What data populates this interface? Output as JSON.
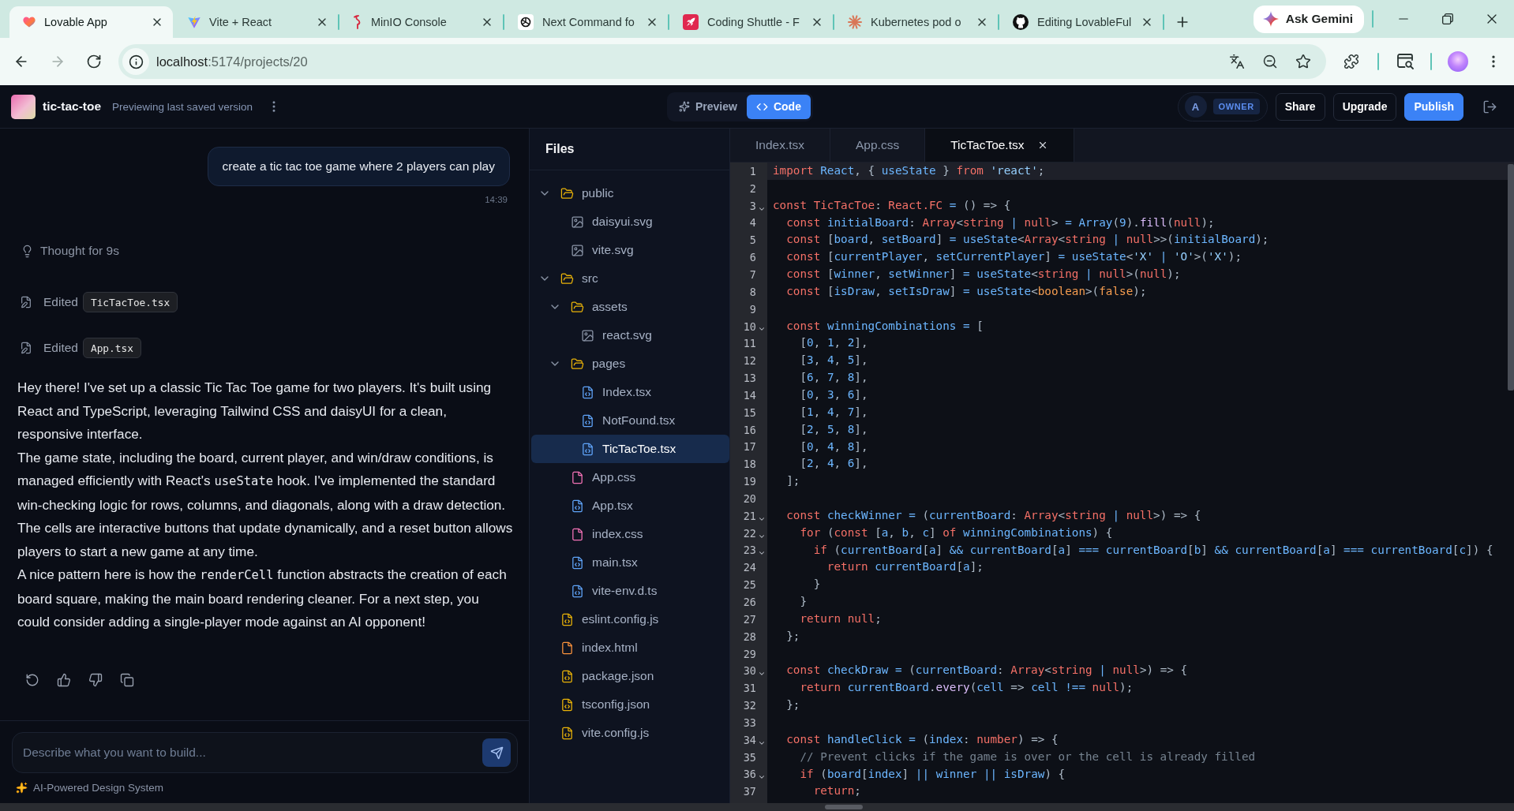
{
  "browser": {
    "tabs": [
      {
        "title": "Lovable App",
        "selected": true
      },
      {
        "title": "Vite + React",
        "selected": false
      },
      {
        "title": "MinIO Console",
        "selected": false
      },
      {
        "title": "Next Command fo",
        "selected": false
      },
      {
        "title": "Coding Shuttle - F",
        "selected": false
      },
      {
        "title": "Kubernetes pod o",
        "selected": false
      },
      {
        "title": "Editing LovableFul",
        "selected": false
      }
    ],
    "gemini_button": "Ask Gemini",
    "nav_buttons": [
      {
        "disabled": false
      },
      {
        "disabled": true
      },
      {
        "disabled": false
      }
    ],
    "address": {
      "host": "localhost",
      "path": ":5174/projects/20"
    }
  },
  "app_header": {
    "project_name": "tic-tac-toe",
    "status": "Previewing last saved version",
    "view_tabs": [
      {
        "label": "Preview",
        "selected": false
      },
      {
        "label": "Code",
        "selected": true
      }
    ],
    "member": {
      "initial": "A",
      "role": "OWNER"
    },
    "buttons": [
      {
        "label": "Share",
        "kind": "secondary"
      },
      {
        "label": "Upgrade",
        "kind": "secondary"
      },
      {
        "label": "Publish",
        "kind": "primary"
      }
    ]
  },
  "chat": {
    "user_message": {
      "text": "create a tic tac toe game where 2 players can play",
      "time": "14:39"
    },
    "thought": "Thought for 9s",
    "edits": [
      {
        "action": "Edited",
        "file": "TicTacToe.tsx"
      },
      {
        "action": "Edited",
        "file": "App.tsx"
      }
    ],
    "reply": [
      [
        {
          "kind": "text",
          "text": "Hey there! I've set up a classic Tic Tac Toe game for two players. It's built using React and TypeScript, leveraging Tailwind CSS and daisyUI for a clean, responsive interface."
        }
      ],
      [
        {
          "kind": "text",
          "text": "The game state, including the board, current player, and win/draw conditions, is managed efficiently with React's "
        },
        {
          "kind": "code",
          "text": "useState"
        },
        {
          "kind": "text",
          "text": " hook. I've implemented the standard win-checking logic for rows, columns, and diagonals, along with a draw detection. The cells are interactive buttons that update dynamically, and a reset button allows players to start a new game at any time."
        }
      ],
      [
        {
          "kind": "text",
          "text": "A nice pattern here is how the "
        },
        {
          "kind": "code",
          "text": "renderCell"
        },
        {
          "kind": "text",
          "text": " function abstracts the creation of each board square, making the main board rendering cleaner. For a next step, you could consider adding a single-player mode against an AI opponent!"
        }
      ]
    ],
    "composer": {
      "placeholder": "Describe what you want to build..."
    },
    "footer_note": "AI-Powered Design System"
  },
  "files": {
    "title": "Files",
    "tree": [
      {
        "name": "public",
        "kind": "folder",
        "expanded": true,
        "selected": false,
        "children": [
          {
            "name": "daisyui.svg",
            "kind": "image",
            "selected": false
          },
          {
            "name": "vite.svg",
            "kind": "image",
            "selected": false
          }
        ]
      },
      {
        "name": "src",
        "kind": "folder",
        "expanded": true,
        "selected": false,
        "children": [
          {
            "name": "assets",
            "kind": "folder",
            "expanded": true,
            "selected": false,
            "children": [
              {
                "name": "react.svg",
                "kind": "image",
                "selected": false
              }
            ]
          },
          {
            "name": "pages",
            "kind": "folder",
            "expanded": true,
            "selected": false,
            "children": [
              {
                "name": "Index.tsx",
                "kind": "script",
                "selected": false
              },
              {
                "name": "NotFound.tsx",
                "kind": "script",
                "selected": false
              },
              {
                "name": "TicTacToe.tsx",
                "kind": "script",
                "selected": true
              }
            ]
          },
          {
            "name": "App.css",
            "kind": "style",
            "selected": false
          },
          {
            "name": "App.tsx",
            "kind": "script",
            "selected": false
          },
          {
            "name": "index.css",
            "kind": "style",
            "selected": false
          },
          {
            "name": "main.tsx",
            "kind": "script",
            "selected": false
          },
          {
            "name": "vite-env.d.ts",
            "kind": "script",
            "selected": false
          }
        ]
      },
      {
        "name": "eslint.config.js",
        "kind": "config",
        "selected": false
      },
      {
        "name": "index.html",
        "kind": "markup",
        "selected": false
      },
      {
        "name": "package.json",
        "kind": "config",
        "selected": false
      },
      {
        "name": "tsconfig.json",
        "kind": "config",
        "selected": false
      },
      {
        "name": "vite.config.js",
        "kind": "config",
        "selected": false
      }
    ]
  },
  "editor": {
    "tabs": [
      {
        "title": "Index.tsx",
        "selected": false
      },
      {
        "title": "App.css",
        "selected": false
      },
      {
        "title": "TicTacToe.tsx",
        "selected": true
      }
    ],
    "lines": [
      {
        "number": "1",
        "active": true,
        "foldable": false,
        "tokens": [
          {
            "kind": "keyword",
            "text": "import "
          },
          {
            "kind": "name",
            "text": "React"
          },
          {
            "kind": "punct",
            "text": ", { "
          },
          {
            "kind": "name",
            "text": "useState"
          },
          {
            "kind": "punct",
            "text": " } "
          },
          {
            "kind": "keyword",
            "text": "from "
          },
          {
            "kind": "string",
            "text": "'react'"
          },
          {
            "kind": "punct",
            "text": ";"
          }
        ]
      },
      {
        "number": "2",
        "active": false,
        "foldable": false
      },
      {
        "number": "3",
        "active": false,
        "foldable": true,
        "tokens": [
          {
            "kind": "keyword",
            "text": "const "
          },
          {
            "kind": "type",
            "text": "TicTacToe"
          },
          {
            "kind": "punct",
            "text": ": "
          },
          {
            "kind": "type",
            "text": "React.FC"
          },
          {
            "kind": "op",
            "text": " = "
          },
          {
            "kind": "punct",
            "text": "() => {"
          }
        ]
      },
      {
        "number": "4",
        "active": false,
        "foldable": false,
        "tokens": [
          {
            "kind": "keyword",
            "text": "  const "
          },
          {
            "kind": "name",
            "text": "initialBoard"
          },
          {
            "kind": "punct",
            "text": ": "
          },
          {
            "kind": "type",
            "text": "Array"
          },
          {
            "kind": "punct",
            "text": "<"
          },
          {
            "kind": "type",
            "text": "string"
          },
          {
            "kind": "op",
            "text": " | "
          },
          {
            "kind": "type",
            "text": "null"
          },
          {
            "kind": "punct",
            "text": "> "
          },
          {
            "kind": "op",
            "text": "= "
          },
          {
            "kind": "name",
            "text": "Array"
          },
          {
            "kind": "punct",
            "text": "("
          },
          {
            "kind": "number",
            "text": "9"
          },
          {
            "kind": "punct",
            "text": ")."
          },
          {
            "kind": "func",
            "text": "fill"
          },
          {
            "kind": "punct",
            "text": "("
          },
          {
            "kind": "type",
            "text": "null"
          },
          {
            "kind": "punct",
            "text": ");"
          }
        ]
      },
      {
        "number": "5",
        "active": false,
        "foldable": false,
        "tokens": [
          {
            "kind": "keyword",
            "text": "  const "
          },
          {
            "kind": "punct",
            "text": "["
          },
          {
            "kind": "name",
            "text": "board"
          },
          {
            "kind": "punct",
            "text": ", "
          },
          {
            "kind": "name",
            "text": "setBoard"
          },
          {
            "kind": "punct",
            "text": "] "
          },
          {
            "kind": "op",
            "text": "= "
          },
          {
            "kind": "name",
            "text": "useState"
          },
          {
            "kind": "punct",
            "text": "<"
          },
          {
            "kind": "type",
            "text": "Array"
          },
          {
            "kind": "punct",
            "text": "<"
          },
          {
            "kind": "type",
            "text": "string"
          },
          {
            "kind": "op",
            "text": " | "
          },
          {
            "kind": "type",
            "text": "null"
          },
          {
            "kind": "punct",
            "text": ">>("
          },
          {
            "kind": "name",
            "text": "initialBoard"
          },
          {
            "kind": "punct",
            "text": ");"
          }
        ]
      },
      {
        "number": "6",
        "active": false,
        "foldable": false,
        "tokens": [
          {
            "kind": "keyword",
            "text": "  const "
          },
          {
            "kind": "punct",
            "text": "["
          },
          {
            "kind": "name",
            "text": "currentPlayer"
          },
          {
            "kind": "punct",
            "text": ", "
          },
          {
            "kind": "name",
            "text": "setCurrentPlayer"
          },
          {
            "kind": "punct",
            "text": "] "
          },
          {
            "kind": "op",
            "text": "= "
          },
          {
            "kind": "name",
            "text": "useState"
          },
          {
            "kind": "punct",
            "text": "<"
          },
          {
            "kind": "string",
            "text": "'X'"
          },
          {
            "kind": "op",
            "text": " | "
          },
          {
            "kind": "string",
            "text": "'O'"
          },
          {
            "kind": "punct",
            "text": ">("
          },
          {
            "kind": "string",
            "text": "'X'"
          },
          {
            "kind": "punct",
            "text": ");"
          }
        ]
      },
      {
        "number": "7",
        "active": false,
        "foldable": false,
        "tokens": [
          {
            "kind": "keyword",
            "text": "  const "
          },
          {
            "kind": "punct",
            "text": "["
          },
          {
            "kind": "name",
            "text": "winner"
          },
          {
            "kind": "punct",
            "text": ", "
          },
          {
            "kind": "name",
            "text": "setWinner"
          },
          {
            "kind": "punct",
            "text": "] "
          },
          {
            "kind": "op",
            "text": "= "
          },
          {
            "kind": "name",
            "text": "useState"
          },
          {
            "kind": "punct",
            "text": "<"
          },
          {
            "kind": "type",
            "text": "string"
          },
          {
            "kind": "op",
            "text": " | "
          },
          {
            "kind": "type",
            "text": "null"
          },
          {
            "kind": "punct",
            "text": ">("
          },
          {
            "kind": "type",
            "text": "null"
          },
          {
            "kind": "punct",
            "text": ");"
          }
        ]
      },
      {
        "number": "8",
        "active": false,
        "foldable": false,
        "tokens": [
          {
            "kind": "keyword",
            "text": "  const "
          },
          {
            "kind": "punct",
            "text": "["
          },
          {
            "kind": "name",
            "text": "isDraw"
          },
          {
            "kind": "punct",
            "text": ", "
          },
          {
            "kind": "name",
            "text": "setIsDraw"
          },
          {
            "kind": "punct",
            "text": "] "
          },
          {
            "kind": "op",
            "text": "= "
          },
          {
            "kind": "name",
            "text": "useState"
          },
          {
            "kind": "punct",
            "text": "<"
          },
          {
            "kind": "literal",
            "text": "boolean"
          },
          {
            "kind": "punct",
            "text": ">("
          },
          {
            "kind": "literal",
            "text": "false"
          },
          {
            "kind": "punct",
            "text": ");"
          }
        ]
      },
      {
        "number": "9",
        "active": false,
        "foldable": false
      },
      {
        "number": "10",
        "active": false,
        "foldable": true,
        "tokens": [
          {
            "kind": "keyword",
            "text": "  const "
          },
          {
            "kind": "name",
            "text": "winningCombinations"
          },
          {
            "kind": "op",
            "text": " = "
          },
          {
            "kind": "punct",
            "text": "["
          }
        ]
      },
      {
        "number": "11",
        "active": false,
        "foldable": false,
        "tokens": [
          {
            "kind": "punct",
            "text": "    ["
          },
          {
            "kind": "number",
            "text": "0"
          },
          {
            "kind": "punct",
            "text": ", "
          },
          {
            "kind": "number",
            "text": "1"
          },
          {
            "kind": "punct",
            "text": ", "
          },
          {
            "kind": "number",
            "text": "2"
          },
          {
            "kind": "punct",
            "text": "],"
          }
        ]
      },
      {
        "number": "12",
        "active": false,
        "foldable": false,
        "tokens": [
          {
            "kind": "punct",
            "text": "    ["
          },
          {
            "kind": "number",
            "text": "3"
          },
          {
            "kind": "punct",
            "text": ", "
          },
          {
            "kind": "number",
            "text": "4"
          },
          {
            "kind": "punct",
            "text": ", "
          },
          {
            "kind": "number",
            "text": "5"
          },
          {
            "kind": "punct",
            "text": "],"
          }
        ]
      },
      {
        "number": "13",
        "active": false,
        "foldable": false,
        "tokens": [
          {
            "kind": "punct",
            "text": "    ["
          },
          {
            "kind": "number",
            "text": "6"
          },
          {
            "kind": "punct",
            "text": ", "
          },
          {
            "kind": "number",
            "text": "7"
          },
          {
            "kind": "punct",
            "text": ", "
          },
          {
            "kind": "number",
            "text": "8"
          },
          {
            "kind": "punct",
            "text": "],"
          }
        ]
      },
      {
        "number": "14",
        "active": false,
        "foldable": false,
        "tokens": [
          {
            "kind": "punct",
            "text": "    ["
          },
          {
            "kind": "number",
            "text": "0"
          },
          {
            "kind": "punct",
            "text": ", "
          },
          {
            "kind": "number",
            "text": "3"
          },
          {
            "kind": "punct",
            "text": ", "
          },
          {
            "kind": "number",
            "text": "6"
          },
          {
            "kind": "punct",
            "text": "],"
          }
        ]
      },
      {
        "number": "15",
        "active": false,
        "foldable": false,
        "tokens": [
          {
            "kind": "punct",
            "text": "    ["
          },
          {
            "kind": "number",
            "text": "1"
          },
          {
            "kind": "punct",
            "text": ", "
          },
          {
            "kind": "number",
            "text": "4"
          },
          {
            "kind": "punct",
            "text": ", "
          },
          {
            "kind": "number",
            "text": "7"
          },
          {
            "kind": "punct",
            "text": "],"
          }
        ]
      },
      {
        "number": "16",
        "active": false,
        "foldable": false,
        "tokens": [
          {
            "kind": "punct",
            "text": "    ["
          },
          {
            "kind": "number",
            "text": "2"
          },
          {
            "kind": "punct",
            "text": ", "
          },
          {
            "kind": "number",
            "text": "5"
          },
          {
            "kind": "punct",
            "text": ", "
          },
          {
            "kind": "number",
            "text": "8"
          },
          {
            "kind": "punct",
            "text": "],"
          }
        ]
      },
      {
        "number": "17",
        "active": false,
        "foldable": false,
        "tokens": [
          {
            "kind": "punct",
            "text": "    ["
          },
          {
            "kind": "number",
            "text": "0"
          },
          {
            "kind": "punct",
            "text": ", "
          },
          {
            "kind": "number",
            "text": "4"
          },
          {
            "kind": "punct",
            "text": ", "
          },
          {
            "kind": "number",
            "text": "8"
          },
          {
            "kind": "punct",
            "text": "],"
          }
        ]
      },
      {
        "number": "18",
        "active": false,
        "foldable": false,
        "tokens": [
          {
            "kind": "punct",
            "text": "    ["
          },
          {
            "kind": "number",
            "text": "2"
          },
          {
            "kind": "punct",
            "text": ", "
          },
          {
            "kind": "number",
            "text": "4"
          },
          {
            "kind": "punct",
            "text": ", "
          },
          {
            "kind": "number",
            "text": "6"
          },
          {
            "kind": "punct",
            "text": "],"
          }
        ]
      },
      {
        "number": "19",
        "active": false,
        "foldable": false,
        "tokens": [
          {
            "kind": "punct",
            "text": "  ];"
          }
        ]
      },
      {
        "number": "20",
        "active": false,
        "foldable": false
      },
      {
        "number": "21",
        "active": false,
        "foldable": true,
        "tokens": [
          {
            "kind": "keyword",
            "text": "  const "
          },
          {
            "kind": "name",
            "text": "checkWinner"
          },
          {
            "kind": "op",
            "text": " = "
          },
          {
            "kind": "punct",
            "text": "("
          },
          {
            "kind": "name",
            "text": "currentBoard"
          },
          {
            "kind": "punct",
            "text": ": "
          },
          {
            "kind": "type",
            "text": "Array"
          },
          {
            "kind": "punct",
            "text": "<"
          },
          {
            "kind": "type",
            "text": "string"
          },
          {
            "kind": "op",
            "text": " | "
          },
          {
            "kind": "type",
            "text": "null"
          },
          {
            "kind": "punct",
            "text": ">) => {"
          }
        ]
      },
      {
        "number": "22",
        "active": false,
        "foldable": true,
        "tokens": [
          {
            "kind": "keyword",
            "text": "    for "
          },
          {
            "kind": "punct",
            "text": "("
          },
          {
            "kind": "keyword",
            "text": "const "
          },
          {
            "kind": "punct",
            "text": "["
          },
          {
            "kind": "name",
            "text": "a"
          },
          {
            "kind": "punct",
            "text": ", "
          },
          {
            "kind": "name",
            "text": "b"
          },
          {
            "kind": "punct",
            "text": ", "
          },
          {
            "kind": "name",
            "text": "c"
          },
          {
            "kind": "punct",
            "text": "] "
          },
          {
            "kind": "keyword",
            "text": "of "
          },
          {
            "kind": "name",
            "text": "winningCombinations"
          },
          {
            "kind": "punct",
            "text": ") {"
          }
        ]
      },
      {
        "number": "23",
        "active": false,
        "foldable": true,
        "tokens": [
          {
            "kind": "keyword",
            "text": "      if "
          },
          {
            "kind": "punct",
            "text": "("
          },
          {
            "kind": "name",
            "text": "currentBoard"
          },
          {
            "kind": "punct",
            "text": "["
          },
          {
            "kind": "name",
            "text": "a"
          },
          {
            "kind": "punct",
            "text": "] "
          },
          {
            "kind": "op",
            "text": "&& "
          },
          {
            "kind": "name",
            "text": "currentBoard"
          },
          {
            "kind": "punct",
            "text": "["
          },
          {
            "kind": "name",
            "text": "a"
          },
          {
            "kind": "punct",
            "text": "] "
          },
          {
            "kind": "op",
            "text": "=== "
          },
          {
            "kind": "name",
            "text": "currentBoard"
          },
          {
            "kind": "punct",
            "text": "["
          },
          {
            "kind": "name",
            "text": "b"
          },
          {
            "kind": "punct",
            "text": "] "
          },
          {
            "kind": "op",
            "text": "&& "
          },
          {
            "kind": "name",
            "text": "currentBoard"
          },
          {
            "kind": "punct",
            "text": "["
          },
          {
            "kind": "name",
            "text": "a"
          },
          {
            "kind": "punct",
            "text": "] "
          },
          {
            "kind": "op",
            "text": "=== "
          },
          {
            "kind": "name",
            "text": "currentBoard"
          },
          {
            "kind": "punct",
            "text": "["
          },
          {
            "kind": "name",
            "text": "c"
          },
          {
            "kind": "punct",
            "text": "]) {"
          }
        ]
      },
      {
        "number": "24",
        "active": false,
        "foldable": false,
        "tokens": [
          {
            "kind": "keyword",
            "text": "        return "
          },
          {
            "kind": "name",
            "text": "currentBoard"
          },
          {
            "kind": "punct",
            "text": "["
          },
          {
            "kind": "name",
            "text": "a"
          },
          {
            "kind": "punct",
            "text": "];"
          }
        ]
      },
      {
        "number": "25",
        "active": false,
        "foldable": false,
        "tokens": [
          {
            "kind": "punct",
            "text": "      }"
          }
        ]
      },
      {
        "number": "26",
        "active": false,
        "foldable": false,
        "tokens": [
          {
            "kind": "punct",
            "text": "    }"
          }
        ]
      },
      {
        "number": "27",
        "active": false,
        "foldable": false,
        "tokens": [
          {
            "kind": "keyword",
            "text": "    return "
          },
          {
            "kind": "type",
            "text": "null"
          },
          {
            "kind": "punct",
            "text": ";"
          }
        ]
      },
      {
        "number": "28",
        "active": false,
        "foldable": false,
        "tokens": [
          {
            "kind": "punct",
            "text": "  };"
          }
        ]
      },
      {
        "number": "29",
        "active": false,
        "foldable": false
      },
      {
        "number": "30",
        "active": false,
        "foldable": true,
        "tokens": [
          {
            "kind": "keyword",
            "text": "  const "
          },
          {
            "kind": "name",
            "text": "checkDraw"
          },
          {
            "kind": "op",
            "text": " = "
          },
          {
            "kind": "punct",
            "text": "("
          },
          {
            "kind": "name",
            "text": "currentBoard"
          },
          {
            "kind": "punct",
            "text": ": "
          },
          {
            "kind": "type",
            "text": "Array"
          },
          {
            "kind": "punct",
            "text": "<"
          },
          {
            "kind": "type",
            "text": "string"
          },
          {
            "kind": "op",
            "text": " | "
          },
          {
            "kind": "type",
            "text": "null"
          },
          {
            "kind": "punct",
            "text": ">) => {"
          }
        ]
      },
      {
        "number": "31",
        "active": false,
        "foldable": false,
        "tokens": [
          {
            "kind": "keyword",
            "text": "    return "
          },
          {
            "kind": "name",
            "text": "currentBoard"
          },
          {
            "kind": "punct",
            "text": "."
          },
          {
            "kind": "func",
            "text": "every"
          },
          {
            "kind": "punct",
            "text": "("
          },
          {
            "kind": "name",
            "text": "cell"
          },
          {
            "kind": "punct",
            "text": " => "
          },
          {
            "kind": "name",
            "text": "cell"
          },
          {
            "kind": "op",
            "text": " !== "
          },
          {
            "kind": "type",
            "text": "null"
          },
          {
            "kind": "punct",
            "text": ");"
          }
        ]
      },
      {
        "number": "32",
        "active": false,
        "foldable": false,
        "tokens": [
          {
            "kind": "punct",
            "text": "  };"
          }
        ]
      },
      {
        "number": "33",
        "active": false,
        "foldable": false
      },
      {
        "number": "34",
        "active": false,
        "foldable": true,
        "tokens": [
          {
            "kind": "keyword",
            "text": "  const "
          },
          {
            "kind": "name",
            "text": "handleClick"
          },
          {
            "kind": "op",
            "text": " = "
          },
          {
            "kind": "punct",
            "text": "("
          },
          {
            "kind": "name",
            "text": "index"
          },
          {
            "kind": "punct",
            "text": ": "
          },
          {
            "kind": "type",
            "text": "number"
          },
          {
            "kind": "punct",
            "text": ") => {"
          }
        ]
      },
      {
        "number": "35",
        "active": false,
        "foldable": false,
        "tokens": [
          {
            "kind": "comment",
            "text": "    // Prevent clicks if the game is over or the cell is already filled"
          }
        ]
      },
      {
        "number": "36",
        "active": false,
        "foldable": true,
        "tokens": [
          {
            "kind": "keyword",
            "text": "    if "
          },
          {
            "kind": "punct",
            "text": "("
          },
          {
            "kind": "name",
            "text": "board"
          },
          {
            "kind": "punct",
            "text": "["
          },
          {
            "kind": "name",
            "text": "index"
          },
          {
            "kind": "punct",
            "text": "] "
          },
          {
            "kind": "op",
            "text": "|| "
          },
          {
            "kind": "name",
            "text": "winner"
          },
          {
            "kind": "op",
            "text": " || "
          },
          {
            "kind": "name",
            "text": "isDraw"
          },
          {
            "kind": "punct",
            "text": ") {"
          }
        ]
      },
      {
        "number": "37",
        "active": false,
        "foldable": false,
        "tokens": [
          {
            "kind": "keyword",
            "text": "      return"
          },
          {
            "kind": "punct",
            "text": ";"
          }
        ]
      }
    ]
  }
}
